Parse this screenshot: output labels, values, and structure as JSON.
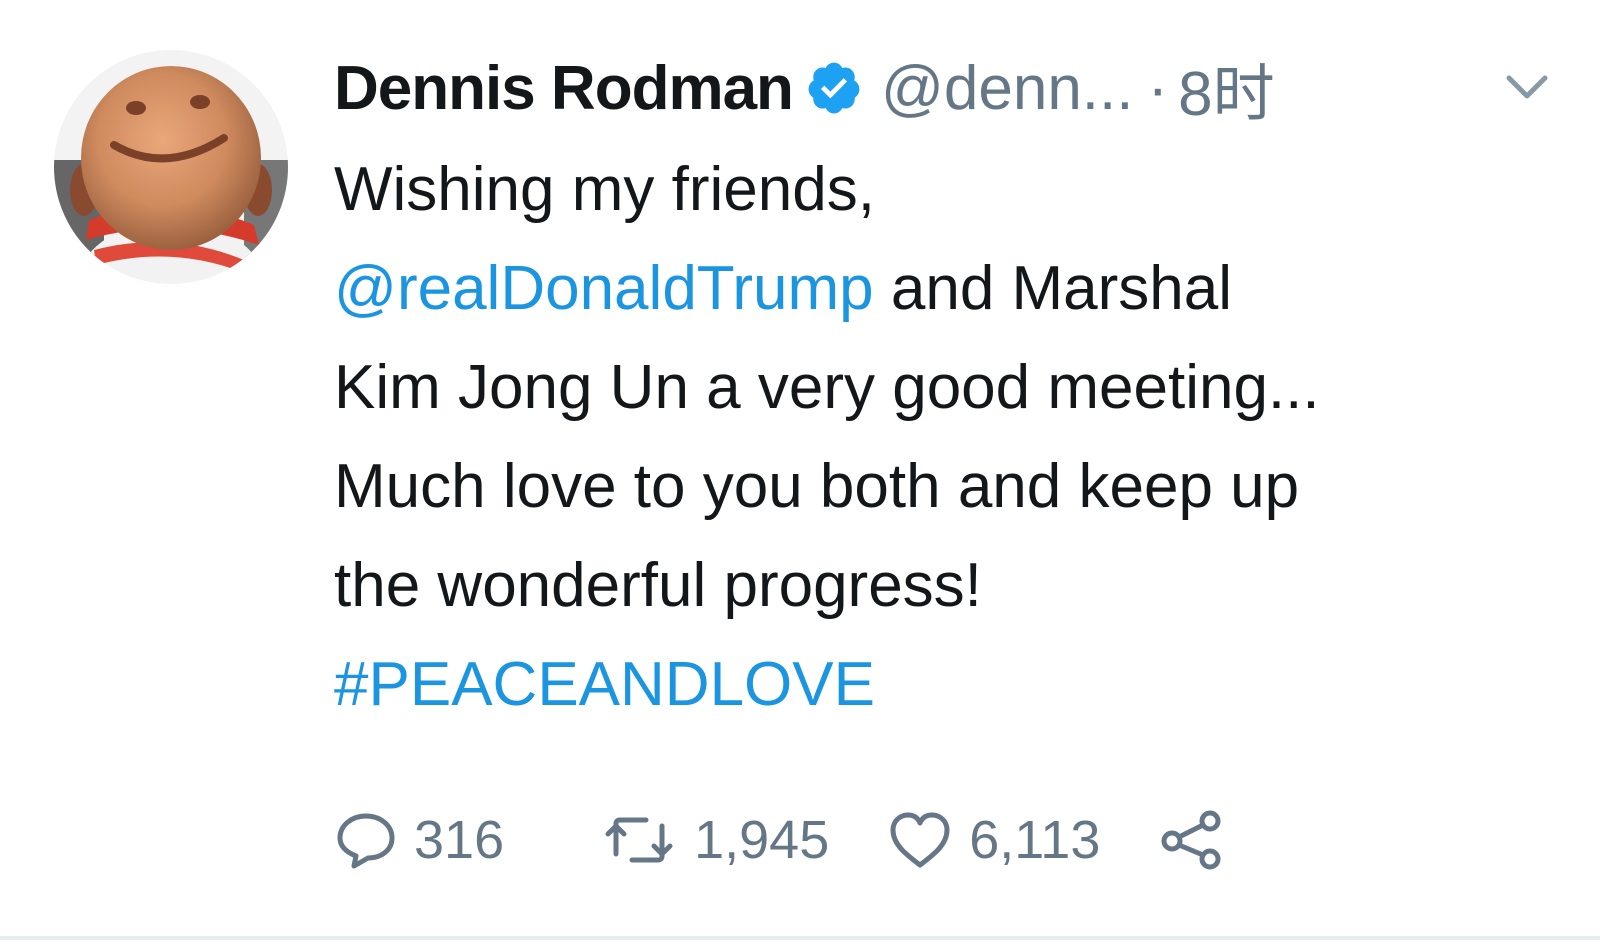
{
  "tweet": {
    "author_name": "Dennis Rodman",
    "handle": "@denn...",
    "separator": "·",
    "time": "8时",
    "verified_icon": "verified-badge-icon",
    "lines": [
      {
        "parts": [
          {
            "text": "Wishing my friends,",
            "link": false
          }
        ]
      },
      {
        "parts": [
          {
            "text": "@realDonaldTrump",
            "link": true
          },
          {
            "text": " and Marshal",
            "link": false
          }
        ]
      },
      {
        "parts": [
          {
            "text": "Kim Jong Un a very good meeting...",
            "link": false
          }
        ]
      },
      {
        "parts": [
          {
            "text": "Much love to you both and keep up",
            "link": false
          }
        ]
      },
      {
        "parts": [
          {
            "text": "the wonderful progress!",
            "link": false
          }
        ]
      },
      {
        "parts": [
          {
            "text": "#PEACEANDLOVE",
            "link": true
          }
        ]
      }
    ]
  },
  "actions": {
    "reply_count": "316",
    "retweet_count": "1,945",
    "like_count": "6,113"
  },
  "colors": {
    "link": "#1b95e0",
    "text": "#14171a",
    "muted": "#657786",
    "verified": "#1da1f2"
  }
}
